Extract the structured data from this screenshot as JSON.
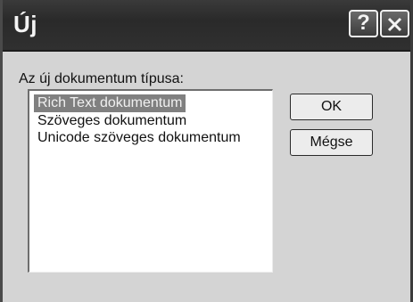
{
  "window": {
    "title": "Új",
    "help_label": "?"
  },
  "dialog": {
    "prompt": "Az új dokumentum típusa:",
    "document_types": [
      "Rich Text dokumentum",
      "Szöveges dokumentum",
      "Unicode szöveges dokumentum"
    ],
    "selected_index": 0
  },
  "buttons": {
    "ok_label": "OK",
    "cancel_label": "Mégse"
  },
  "colors": {
    "title_bar": "#2e2e2e",
    "selection": "#808080",
    "dialog_face": "#d4d4d4"
  },
  "icons": {
    "help": "question-mark-icon",
    "close": "close-x-icon"
  }
}
